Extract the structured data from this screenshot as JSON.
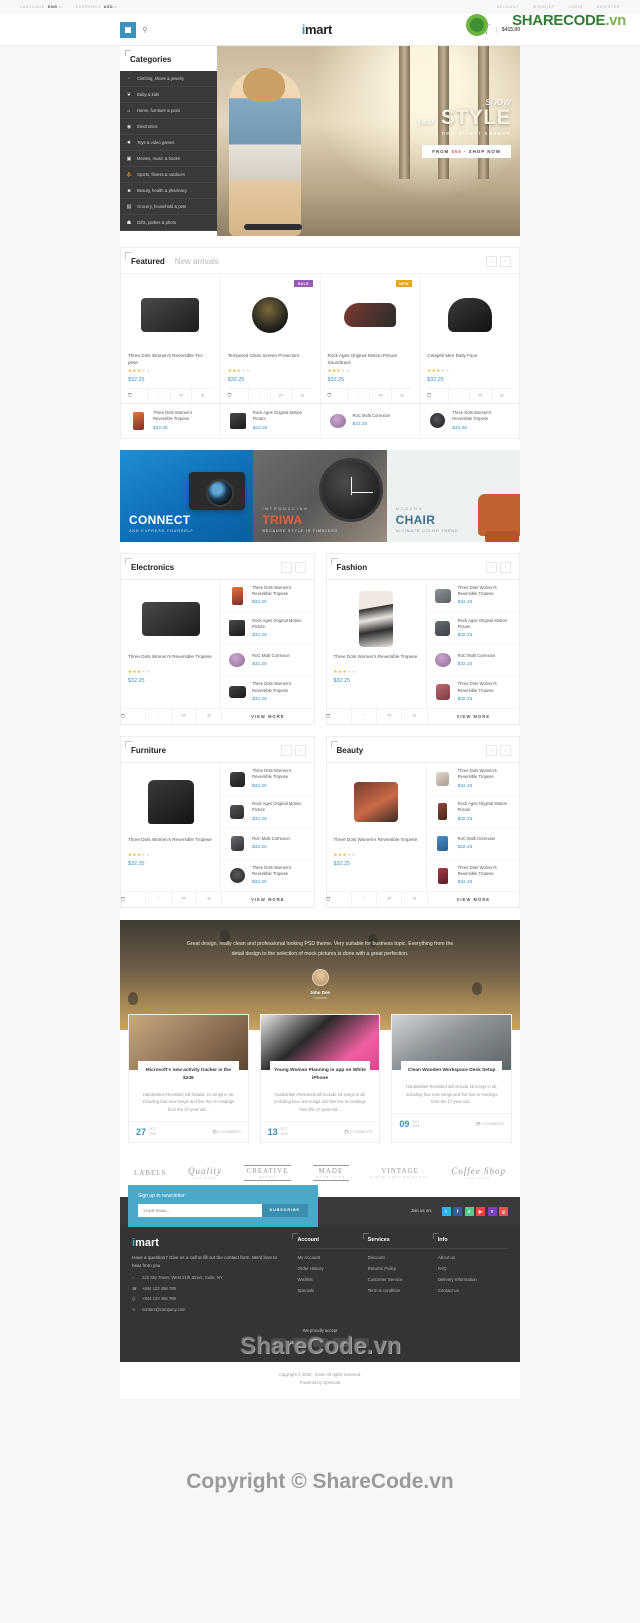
{
  "topbar": {
    "language_label": "LANGUAGE:",
    "language_value": "ENG",
    "currency_label": "CURRENCY:",
    "currency_value": "USD",
    "links": [
      "ACCOUNT",
      "WISHLIST",
      "LOGIN",
      "REGISTER"
    ]
  },
  "header": {
    "logo_i": "i",
    "logo_rest": "mart",
    "cart_label": "MY CART",
    "cart_total": "$415.00"
  },
  "categories": {
    "title": "Categories",
    "items": [
      {
        "icon": "bag-icon",
        "glyph": "▫",
        "label": "Clothing, shoes & jewelry"
      },
      {
        "icon": "baby-icon",
        "glyph": "❦",
        "label": "Baby & kids"
      },
      {
        "icon": "home-icon",
        "glyph": "⌂",
        "label": "Home, furniture & patio"
      },
      {
        "icon": "electronics-icon",
        "glyph": "◉",
        "label": "Electronics"
      },
      {
        "icon": "toys-icon",
        "glyph": "✸",
        "label": "Toys & video games"
      },
      {
        "icon": "media-icon",
        "glyph": "▣",
        "label": "Movies, music & books"
      },
      {
        "icon": "sports-icon",
        "glyph": "⛹",
        "label": "Sports, fitness & outdoors"
      },
      {
        "icon": "beauty-icon",
        "glyph": "■",
        "label": "Beauty, health & pharmacy"
      },
      {
        "icon": "grocery-icon",
        "glyph": "▤",
        "label": "Grocery, household & pets"
      },
      {
        "icon": "gifts-icon",
        "glyph": "☗",
        "label": "Gifts, parties & photo"
      }
    ]
  },
  "hero": {
    "show": "show",
    "your": "your",
    "style": "STYLE",
    "subtitle": "new street season",
    "cta_from": "FROM",
    "cta_price": "$66",
    "cta_rest": "- SHOP NOW"
  },
  "featured": {
    "tab_active": "Featured",
    "tab_second": "New arrivals",
    "prev": "‹",
    "next": "›",
    "products": [
      {
        "name": "Three Dots Women's Reversible Tro-pese",
        "price": "$32.25",
        "stars": 3,
        "badge": null,
        "image": "camera-body"
      },
      {
        "name": "Tempered Glass Screen Protectors",
        "price": "$32.25",
        "stars": 3,
        "badge": "SALE",
        "badge_type": "sale",
        "image": "lens"
      },
      {
        "name": "Rock Ages Original Motion Picture Soundtrack",
        "price": "$32.25",
        "stars": 3,
        "badge": "NEW",
        "badge_type": "new",
        "image": "sneaker"
      },
      {
        "name": "Cetaphil Men Daily Face",
        "price": "$32.25",
        "stars": 3,
        "badge": null,
        "image": "headphones"
      }
    ],
    "mini": [
      {
        "name": "Three Dots Women's Reversible Tropese",
        "price": "$32.25",
        "image": "phone"
      },
      {
        "name": "Rock Ages Original Motion Picture",
        "price": "$32.25",
        "image": "speaker"
      },
      {
        "name": "RoC Multi Correxion",
        "price": "$32.25",
        "image": "toy"
      },
      {
        "name": "Three Dots Women's Reversible Tropese",
        "price": "$32.25",
        "image": "watch"
      }
    ],
    "actions": [
      {
        "name": "add-to-cart",
        "glyph": "⛉"
      },
      {
        "name": "wishlist",
        "glyph": "♡"
      },
      {
        "name": "compare",
        "glyph": "⇄"
      },
      {
        "name": "quickview",
        "glyph": "⊕"
      }
    ]
  },
  "promos": [
    {
      "eyebrow": "",
      "heading": "CONNECT",
      "sub": "AND EXPRESS YOURSELF",
      "image": "camera-splash"
    },
    {
      "eyebrow": "INTRODUCING",
      "heading": "TRIWA",
      "sub": "BECAUSE STYLE IS TIMELESS",
      "image": "watch"
    },
    {
      "eyebrow": "MODERN",
      "heading": "CHAIR",
      "sub": "ULTIMATE COLOR TREND",
      "image": "armchair"
    }
  ],
  "blocks": [
    {
      "title": "Electronics",
      "view_more": "VIEW MORE",
      "feature": {
        "name": "Three Dots Women's Reversible Tropese",
        "price": "$32.25",
        "stars": 3,
        "image": "camera-body"
      },
      "list": [
        {
          "name": "Three Dots Women's Reversible Tropese",
          "price": "$32.25",
          "image": "phone"
        },
        {
          "name": "Rock Ages Original Motion Picture",
          "price": "$32.25",
          "image": "speaker"
        },
        {
          "name": "RoC Multi Correxion",
          "price": "$32.25",
          "image": "toy"
        },
        {
          "name": "Three Dots Women's Reversible Tropese",
          "price": "$32.25",
          "image": "camera"
        }
      ]
    },
    {
      "title": "Fashion",
      "view_more": "VIEW MORE",
      "feature": {
        "name": "Three Dots Women's Reversible Tropese",
        "price": "$32.25",
        "stars": 3,
        "image": "dress"
      },
      "list": [
        {
          "name": "Three Dots Women's Reversible Tropese",
          "price": "$32.25",
          "image": "shirt"
        },
        {
          "name": "Rock Ages Original Motion Picture",
          "price": "$32.25",
          "image": "jacket"
        },
        {
          "name": "RoC Multi Correxion",
          "price": "$32.25",
          "image": "toy"
        },
        {
          "name": "Three Dots Women's Reversible Tropese",
          "price": "$32.25",
          "image": "dress2"
        }
      ]
    },
    {
      "title": "Furniture",
      "view_more": "VIEW MORE",
      "feature": {
        "name": "Three Dots Women's Reversible Tropese",
        "price": "$32.25",
        "stars": 3,
        "image": "armchair"
      },
      "list": [
        {
          "name": "Three Dots Women's Reversible Tropese",
          "price": "$32.25",
          "image": "chair"
        },
        {
          "name": "Rock Ages Original Motion Picture",
          "price": "$32.25",
          "image": "stool"
        },
        {
          "name": "RoC Multi Correxion",
          "price": "$32.25",
          "image": "lamp"
        },
        {
          "name": "Three Dots Women's Reversible Tropese",
          "price": "$32.25",
          "image": "clock"
        }
      ]
    },
    {
      "title": "Beauty",
      "view_more": "VIEW MORE",
      "feature": {
        "name": "Three Dots Women's Reversible Tropese",
        "price": "$32.25",
        "stars": 3,
        "image": "cosmetics"
      },
      "list": [
        {
          "name": "Three Dots Women's Reversible Tropese",
          "price": "$32.25",
          "image": "cream"
        },
        {
          "name": "Rock Ages Original Motion Picture",
          "price": "$32.25",
          "image": "bottle"
        },
        {
          "name": "RoC Multi Correxion",
          "price": "$32.25",
          "image": "tube"
        },
        {
          "name": "Three Dots Women's Reversible Tropese",
          "price": "$32.25",
          "image": "lipstick"
        }
      ]
    }
  ],
  "testimonial": {
    "quote": "Great design, really clean and professional looking PSD theme. Very suitable for business topic. Everything from the detail design to the selection of mock pictures is done with a great perfection.",
    "author": "John Doe",
    "role": "Customer"
  },
  "blog": [
    {
      "title": "Microsoft's new activity tracker is the $249",
      "excerpt": "Handwritten Revisited will include 16 songs in all, including four new songs and five live re-cordings from the 17-year-old...",
      "day": "27",
      "month": "OCT",
      "year": "2016",
      "comments": "0 COMMENTS"
    },
    {
      "title": "Young Woman Planning in app on White iPhone",
      "excerpt": "Handwritten Revisited will include 16 songs in all, including four new songs and five live re-cordings from the 17-year-old...",
      "day": "13",
      "month": "OCT",
      "year": "2016",
      "comments": "0 COMMENTS"
    },
    {
      "title": "Clean Wooden Workspace Desk Setup",
      "excerpt": "Handwritten Revisited will include 16 songs in all, including four new songs and five live re-cordings from the 17-year-old...",
      "day": "09",
      "month": "OCT",
      "year": "2016",
      "comments": "0 COMMENTS"
    }
  ],
  "brands": [
    {
      "name": "LABELS",
      "sub": ""
    },
    {
      "name": "Quality",
      "sub": "EST 1980"
    },
    {
      "name": "CREATIVE",
      "sub": "MINDS"
    },
    {
      "name": "MADE",
      "sub": "WITH LOVE"
    },
    {
      "name": "VINTAGE",
      "sub": "SINCE 1962 ORIGINAL"
    },
    {
      "name": "Coffee Shop",
      "sub": "EST 1974"
    }
  ],
  "newsletter": {
    "title": "Sign up to newsletter:",
    "placeholder": "YOUR EMAIL..",
    "button": "SUBSCRIBE"
  },
  "social": {
    "join_label": "Join us on:",
    "icons": [
      {
        "name": "twitter-icon",
        "glyph": "t",
        "color": "#29b6e8"
      },
      {
        "name": "facebook-icon",
        "glyph": "f",
        "color": "#3b5998"
      },
      {
        "name": "vimeo-icon",
        "glyph": "v",
        "color": "#4ecb8d"
      },
      {
        "name": "youtube-icon",
        "glyph": "▶",
        "color": "#e8453c"
      },
      {
        "name": "yahoo-icon",
        "glyph": "Y",
        "color": "#7b3fbf"
      },
      {
        "name": "google-icon",
        "glyph": "g",
        "color": "#e05a3c"
      }
    ]
  },
  "footer": {
    "logo_i": "i",
    "logo_rest": "mart",
    "desc": "Have a question? Give us a call or fill out the contact form. We'd love to hear from you",
    "contacts": [
      {
        "icon": "location-icon",
        "glyph": "⌂",
        "text": "123 Sky Tower, West 21th Street, Suite, NY"
      },
      {
        "icon": "phone-icon",
        "glyph": "☎",
        "text": "+844 123 456 789"
      },
      {
        "icon": "fax-icon",
        "glyph": "⎙",
        "text": "+844 123 456 789"
      },
      {
        "icon": "mail-icon",
        "glyph": "✉",
        "text": "contact@company.com"
      }
    ],
    "columns": [
      {
        "head": "Account",
        "links": [
          "My Account",
          "Order History",
          "Wishlist",
          "Specials"
        ]
      },
      {
        "head": "Services",
        "links": [
          "Discount",
          "Returns Policy",
          "Customer Service",
          "Term & condition"
        ]
      },
      {
        "head": "Info",
        "links": [
          "About us",
          "FAQ",
          "Delivery Information",
          "Contact us"
        ]
      }
    ],
    "pay_title": "We proudly accept",
    "copyright_1": "Copyright © 2016 - imart. All rights reserved.",
    "copyright_2": "Powered by Opencart"
  },
  "watermarks": {
    "logo_share": "SHARE",
    "logo_code": "CODE",
    "logo_vn": ".vn",
    "mid": "ShareCode.vn",
    "copy": "Copyright © ShareCode.vn"
  }
}
